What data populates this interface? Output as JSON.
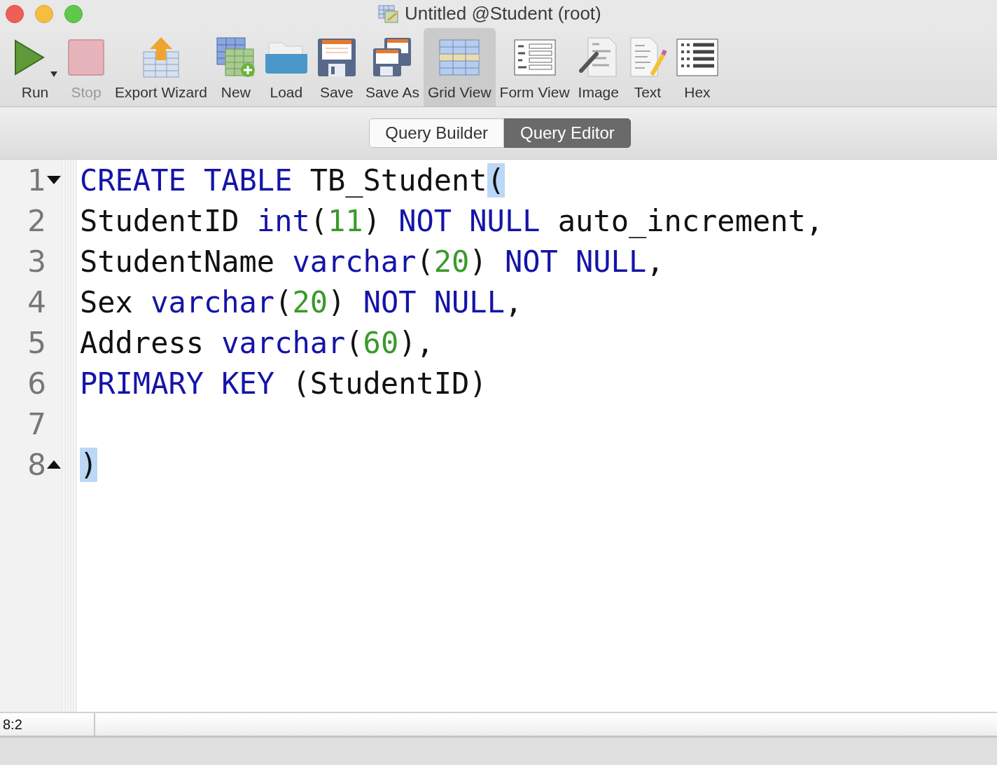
{
  "window": {
    "title": "Untitled @Student (root)"
  },
  "toolbar": [
    {
      "label": "Run",
      "selected": false,
      "disabled": false,
      "dropdown": true
    },
    {
      "label": "Stop",
      "selected": false,
      "disabled": true,
      "dropdown": false
    },
    {
      "label": "Export Wizard",
      "selected": false,
      "disabled": false,
      "dropdown": false
    },
    {
      "label": "New",
      "selected": false,
      "disabled": false,
      "dropdown": false
    },
    {
      "label": "Load",
      "selected": false,
      "disabled": false,
      "dropdown": false
    },
    {
      "label": "Save",
      "selected": false,
      "disabled": false,
      "dropdown": false
    },
    {
      "label": "Save As",
      "selected": false,
      "disabled": false,
      "dropdown": false
    },
    {
      "label": "Grid View",
      "selected": true,
      "disabled": false,
      "dropdown": false
    },
    {
      "label": "Form View",
      "selected": false,
      "disabled": false,
      "dropdown": false
    },
    {
      "label": "Image",
      "selected": false,
      "disabled": false,
      "dropdown": false
    },
    {
      "label": "Text",
      "selected": false,
      "disabled": false,
      "dropdown": false
    },
    {
      "label": "Hex",
      "selected": false,
      "disabled": false,
      "dropdown": false
    }
  ],
  "mode_tabs": [
    {
      "label": "Query Builder",
      "selected": false
    },
    {
      "label": "Query Editor",
      "selected": true
    }
  ],
  "editor": {
    "lines": [
      {
        "number": "1",
        "fold_start": true,
        "fold_end": false,
        "tokens": [
          {
            "kind": "keyword",
            "text": "CREATE TABLE"
          },
          {
            "kind": "plain",
            "text": " TB_Student"
          },
          {
            "kind": "match",
            "text": "("
          }
        ]
      },
      {
        "number": "2",
        "fold_start": false,
        "fold_end": false,
        "tokens": [
          {
            "kind": "plain",
            "text": "StudentID "
          },
          {
            "kind": "keyword",
            "text": "int"
          },
          {
            "kind": "plain",
            "text": "("
          },
          {
            "kind": "number",
            "text": "11"
          },
          {
            "kind": "plain",
            "text": ") "
          },
          {
            "kind": "keyword",
            "text": "NOT NULL"
          },
          {
            "kind": "plain",
            "text": " auto_increment,"
          }
        ]
      },
      {
        "number": "3",
        "fold_start": false,
        "fold_end": false,
        "tokens": [
          {
            "kind": "plain",
            "text": "StudentName "
          },
          {
            "kind": "keyword",
            "text": "varchar"
          },
          {
            "kind": "plain",
            "text": "("
          },
          {
            "kind": "number",
            "text": "20"
          },
          {
            "kind": "plain",
            "text": ") "
          },
          {
            "kind": "keyword",
            "text": "NOT NULL"
          },
          {
            "kind": "plain",
            "text": ","
          }
        ]
      },
      {
        "number": "4",
        "fold_start": false,
        "fold_end": false,
        "tokens": [
          {
            "kind": "plain",
            "text": "Sex "
          },
          {
            "kind": "keyword",
            "text": "varchar"
          },
          {
            "kind": "plain",
            "text": "("
          },
          {
            "kind": "number",
            "text": "20"
          },
          {
            "kind": "plain",
            "text": ") "
          },
          {
            "kind": "keyword",
            "text": "NOT NULL"
          },
          {
            "kind": "plain",
            "text": ","
          }
        ]
      },
      {
        "number": "5",
        "fold_start": false,
        "fold_end": false,
        "tokens": [
          {
            "kind": "plain",
            "text": "Address "
          },
          {
            "kind": "keyword",
            "text": "varchar"
          },
          {
            "kind": "plain",
            "text": "("
          },
          {
            "kind": "number",
            "text": "60"
          },
          {
            "kind": "plain",
            "text": "),"
          }
        ]
      },
      {
        "number": "6",
        "fold_start": false,
        "fold_end": false,
        "tokens": [
          {
            "kind": "keyword",
            "text": "PRIMARY KEY"
          },
          {
            "kind": "plain",
            "text": " (StudentID)"
          }
        ]
      },
      {
        "number": "7",
        "fold_start": false,
        "fold_end": false
      },
      {
        "number": "8",
        "fold_start": false,
        "fold_end": true,
        "tokens": [
          {
            "kind": "match",
            "text": ")"
          }
        ]
      }
    ]
  },
  "status_bar": {
    "position": "8:2"
  }
}
